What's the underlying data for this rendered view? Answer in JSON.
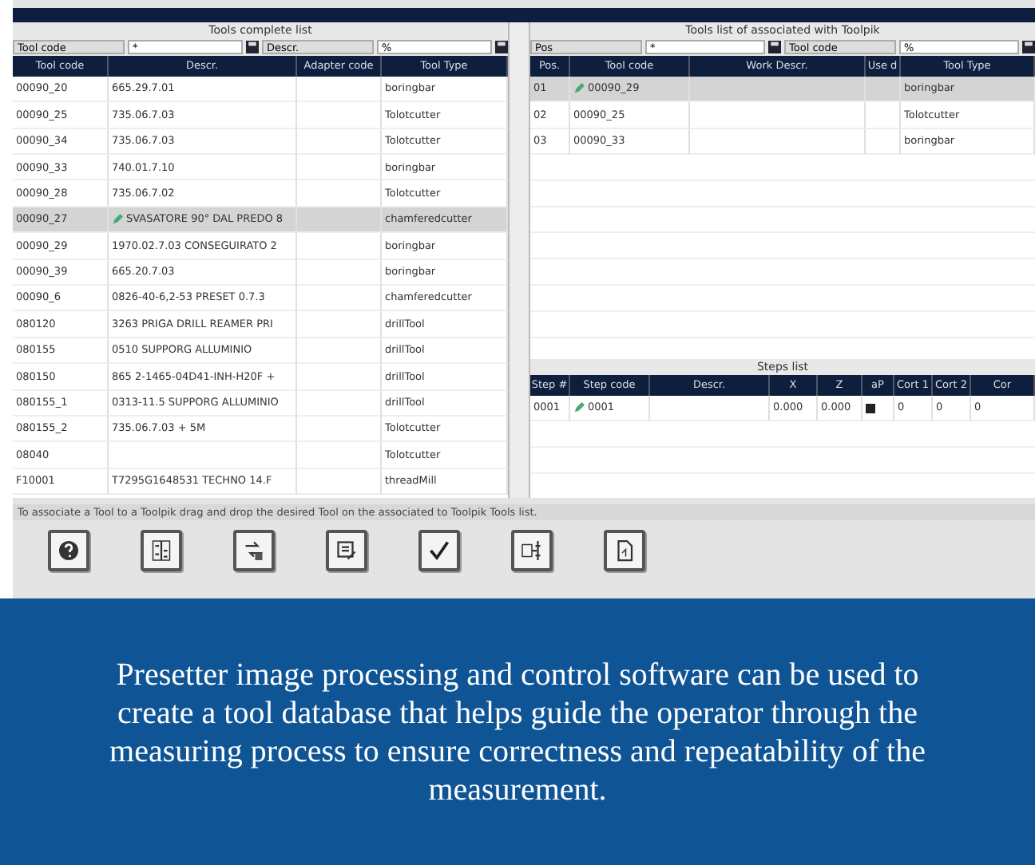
{
  "tools_list": {
    "title": "Tools complete list",
    "filters": [
      {
        "field": "Tool code",
        "value": "*"
      },
      {
        "field": "Descr.",
        "value": "%"
      }
    ],
    "columns": [
      "Tool code",
      "Descr.",
      "Adapter code",
      "Tool Type"
    ],
    "rows": [
      {
        "cells": [
          "00090_20",
          "665.29.7.01",
          "",
          "boringbar"
        ],
        "selected": false,
        "marked": false
      },
      {
        "cells": [
          "00090_25",
          "735.06.7.03",
          "",
          "Tolotcutter"
        ],
        "selected": false,
        "marked": false
      },
      {
        "cells": [
          "00090_34",
          "735.06.7.03",
          "",
          "Tolotcutter"
        ],
        "selected": false,
        "marked": false
      },
      {
        "cells": [
          "00090_33",
          "740.01.7.10",
          "",
          "boringbar"
        ],
        "selected": false,
        "marked": false
      },
      {
        "cells": [
          "00090_28",
          "735.06.7.02",
          "",
          "Tolotcutter"
        ],
        "selected": false,
        "marked": false
      },
      {
        "cells": [
          "00090_27",
          "SVASATORE 90° DAL PREDO 8",
          "",
          "chamferedcutter"
        ],
        "selected": true,
        "marked": true
      },
      {
        "cells": [
          "00090_29",
          "1970.02.7.03 CONSEGUIRATO 2",
          "",
          "boringbar"
        ],
        "selected": false,
        "marked": false
      },
      {
        "cells": [
          "00090_39",
          "665.20.7.03",
          "",
          "boringbar"
        ],
        "selected": false,
        "marked": false
      },
      {
        "cells": [
          "00090_6",
          "0826-40-6,2-53 PRESET 0.7.3",
          "",
          "chamferedcutter"
        ],
        "selected": false,
        "marked": false
      },
      {
        "cells": [
          "080120",
          "3263 PRIGA DRILL REAMER PRI",
          "",
          "drillTool"
        ],
        "selected": false,
        "marked": false
      },
      {
        "cells": [
          "080155",
          "0510 SUPPORG ALLUMINIO",
          "",
          "drillTool"
        ],
        "selected": false,
        "marked": false
      },
      {
        "cells": [
          "080150",
          "865 2-1465-04D41-INH-H20F +",
          "",
          "drillTool"
        ],
        "selected": false,
        "marked": false
      },
      {
        "cells": [
          "080155_1",
          "0313-11.5 SUPPORG ALLUMINIO",
          "",
          "drillTool"
        ],
        "selected": false,
        "marked": false
      },
      {
        "cells": [
          "080155_2",
          "735.06.7.03 + 5M",
          "",
          "Tolotcutter"
        ],
        "selected": false,
        "marked": false
      },
      {
        "cells": [
          "08040",
          "",
          "",
          "Tolotcutter"
        ],
        "selected": false,
        "marked": false
      },
      {
        "cells": [
          "F10001",
          "T7295G1648531 TECHNO 14.F",
          "",
          "threadMill"
        ],
        "selected": false,
        "marked": false
      }
    ]
  },
  "toolpik_list": {
    "title": "Tools list of associated with Toolpik",
    "filters": [
      {
        "field": "Pos",
        "value": "*"
      },
      {
        "field": "Tool code",
        "value": "%"
      }
    ],
    "columns": [
      "Pos.",
      "Tool code",
      "Work Descr.",
      "Use d",
      "Tool Type"
    ],
    "rows": [
      {
        "cells": [
          "01",
          "00090_29",
          "",
          "",
          "boringbar"
        ],
        "selected": true,
        "marked": true
      },
      {
        "cells": [
          "02",
          "00090_25",
          "",
          "",
          "Tolotcutter"
        ],
        "selected": false,
        "marked": false
      },
      {
        "cells": [
          "03",
          "00090_33",
          "",
          "",
          "boringbar"
        ],
        "selected": false,
        "marked": false
      }
    ]
  },
  "steps_list": {
    "title": "Steps list",
    "columns": [
      "Step #",
      "Step code",
      "Descr.",
      "X",
      "Z",
      "aP",
      "Cort 1",
      "Cort 2",
      "Cor"
    ],
    "rows": [
      {
        "cells": [
          "0001",
          "0001",
          "",
          "0.000",
          "0.000",
          "",
          "0",
          "0",
          "0"
        ],
        "selected": false,
        "marked": true,
        "ap_checked": true
      }
    ]
  },
  "status_bar": "To associate a Tool to a Toolpik drag and drop the desired Tool on the associated to Toolpik Tools list.",
  "toolbar": [
    {
      "kind": "help"
    },
    {
      "kind": "columns"
    },
    {
      "kind": "swap"
    },
    {
      "kind": "edit"
    },
    {
      "kind": "confirm"
    },
    {
      "kind": "compare"
    },
    {
      "kind": "document"
    }
  ],
  "caption": "Presetter image processing and control software can be used to create a tool database that helps guide the operator through the measuring process to ensure correctness and repeatability of the measurement."
}
